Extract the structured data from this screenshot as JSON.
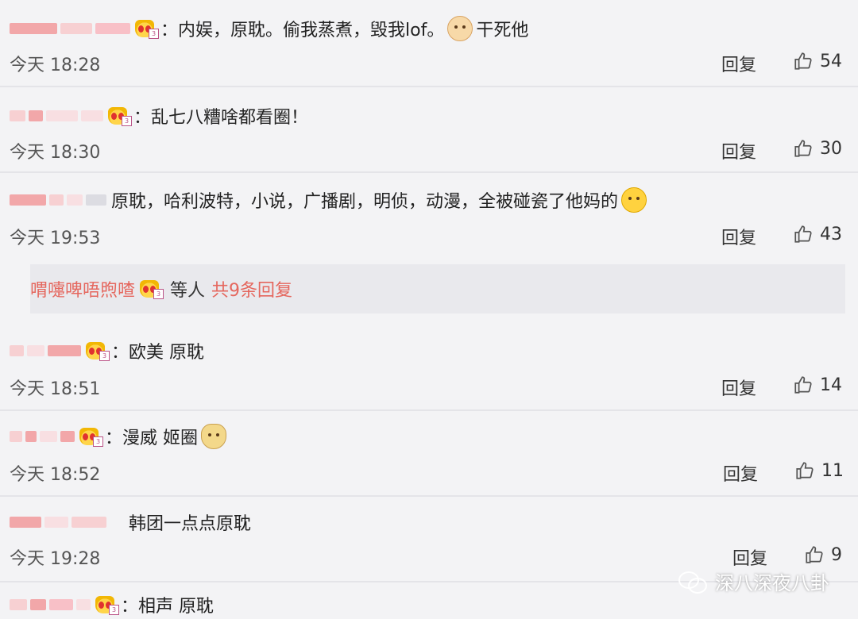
{
  "comments": [
    {
      "text": "：内娱，原耽。偷我蒸煮，毁我lof。",
      "after_emoji_text": "干死他",
      "time": "今天 18:28",
      "reply": "回复",
      "likes": "54"
    },
    {
      "text": "：乱七八糟啥都看圈！",
      "time": "今天 18:30",
      "reply": "回复",
      "likes": "30"
    },
    {
      "text": "原耽，哈利波特，小说，广播剧，明侦，动漫，全被碰瓷了他妈的",
      "time": "今天 19:53",
      "reply": "回复",
      "likes": "43"
    },
    {
      "text": "：欧美 原耽",
      "time": "今天 18:51",
      "reply": "回复",
      "likes": "14"
    },
    {
      "text": "：漫威 姬圈",
      "time": "今天 18:52",
      "reply": "回复",
      "likes": "11"
    },
    {
      "text": "韩团一点点原耽",
      "time": "今天 19:28",
      "reply": "回复",
      "likes": "9"
    },
    {
      "text": "：相声  原耽"
    }
  ],
  "replies_box": {
    "users": "喟嚏啤唔煦喳",
    "etc": "等人",
    "total": "共9条回复"
  },
  "watermark": "深八深夜八卦",
  "icons": {
    "like": "thumbs-up-icon",
    "badge": "vip-crown-icon",
    "emoji": "face-emoji-icon",
    "watermark": "wechat-icon"
  },
  "colors": {
    "link_red": "#e5675e",
    "background": "#f3f3f5"
  }
}
